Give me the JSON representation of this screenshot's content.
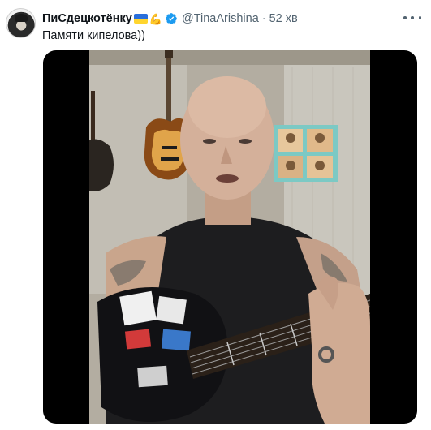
{
  "tweet": {
    "display_name": "ПиСдецкотёнку",
    "handle": "@TinaArishina",
    "separator": "·",
    "time": "52 хв",
    "text": "Памяти кипелова))",
    "flag_colors": [
      "#2a6fdb",
      "#ffd52e"
    ],
    "verified_color": "#1d9bf0"
  },
  "icons": {
    "avatar": "avatar-image",
    "flag": "ukraine-flag-icon",
    "arm": "flexed-biceps-icon",
    "verified": "verified-badge-icon",
    "more": "more-options-icon"
  },
  "media": {
    "kind": "video",
    "scene": "bald man singing while playing an acoustic guitar in a room with wall-mounted guitars and a poster"
  }
}
